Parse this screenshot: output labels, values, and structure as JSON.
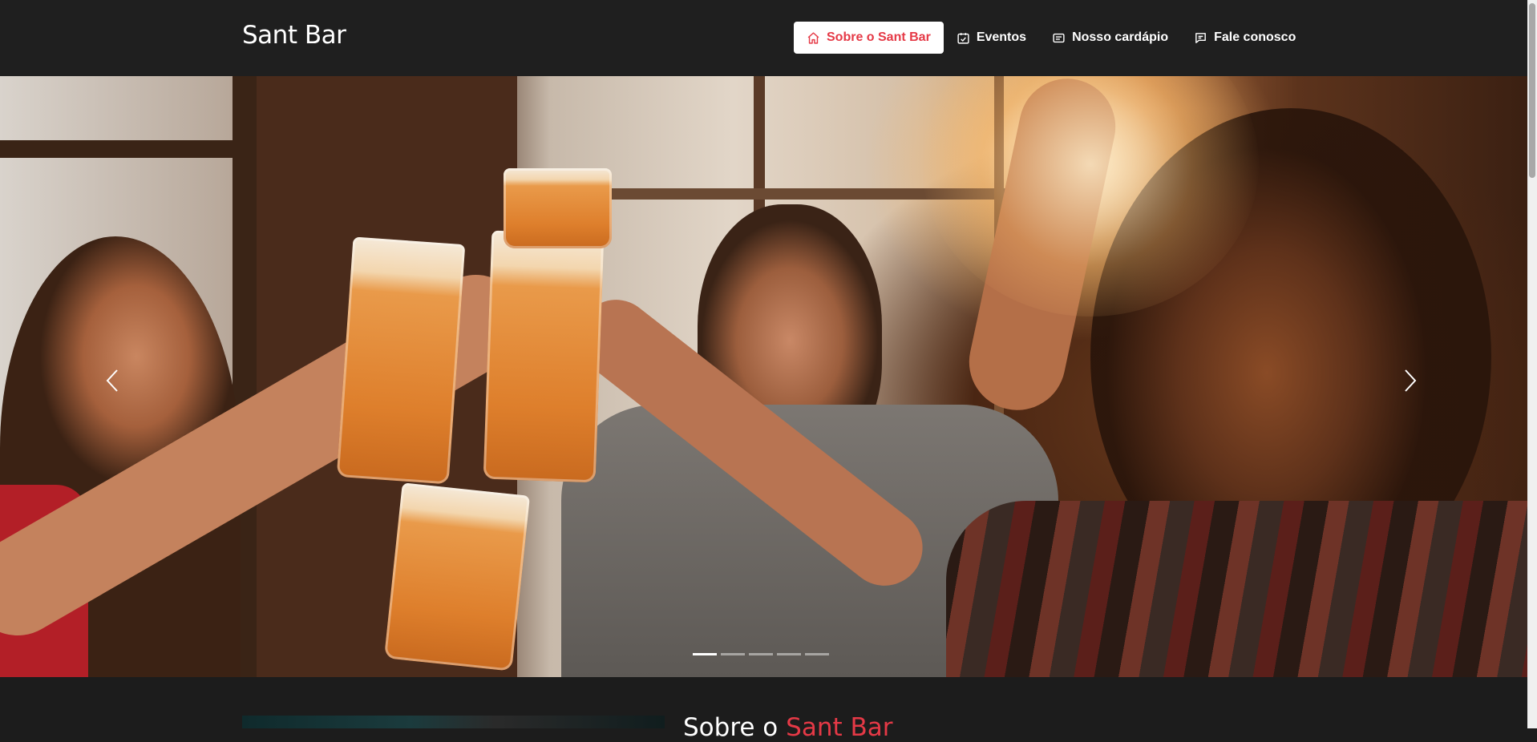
{
  "header": {
    "brand": "Sant Bar",
    "nav": [
      {
        "label": "Sobre o Sant Bar",
        "icon": "home-icon",
        "active": true
      },
      {
        "label": "Eventos",
        "icon": "calendar-check-icon",
        "active": false
      },
      {
        "label": "Nosso cardápio",
        "icon": "menu-card-icon",
        "active": false
      },
      {
        "label": "Fale conosco",
        "icon": "chat-icon",
        "active": false
      }
    ]
  },
  "carousel": {
    "image": "friends-toasting-beer-photo",
    "prev_icon": "chevron-left-icon",
    "next_icon": "chevron-right-icon",
    "slide_count": 5,
    "active_slide": 1
  },
  "about": {
    "title_prefix": "Sobre o ",
    "title_accent": "Sant Bar"
  },
  "colors": {
    "accent": "#e53946",
    "header_bg": "#1f1f1f",
    "page_bg": "#1c1c1c"
  }
}
